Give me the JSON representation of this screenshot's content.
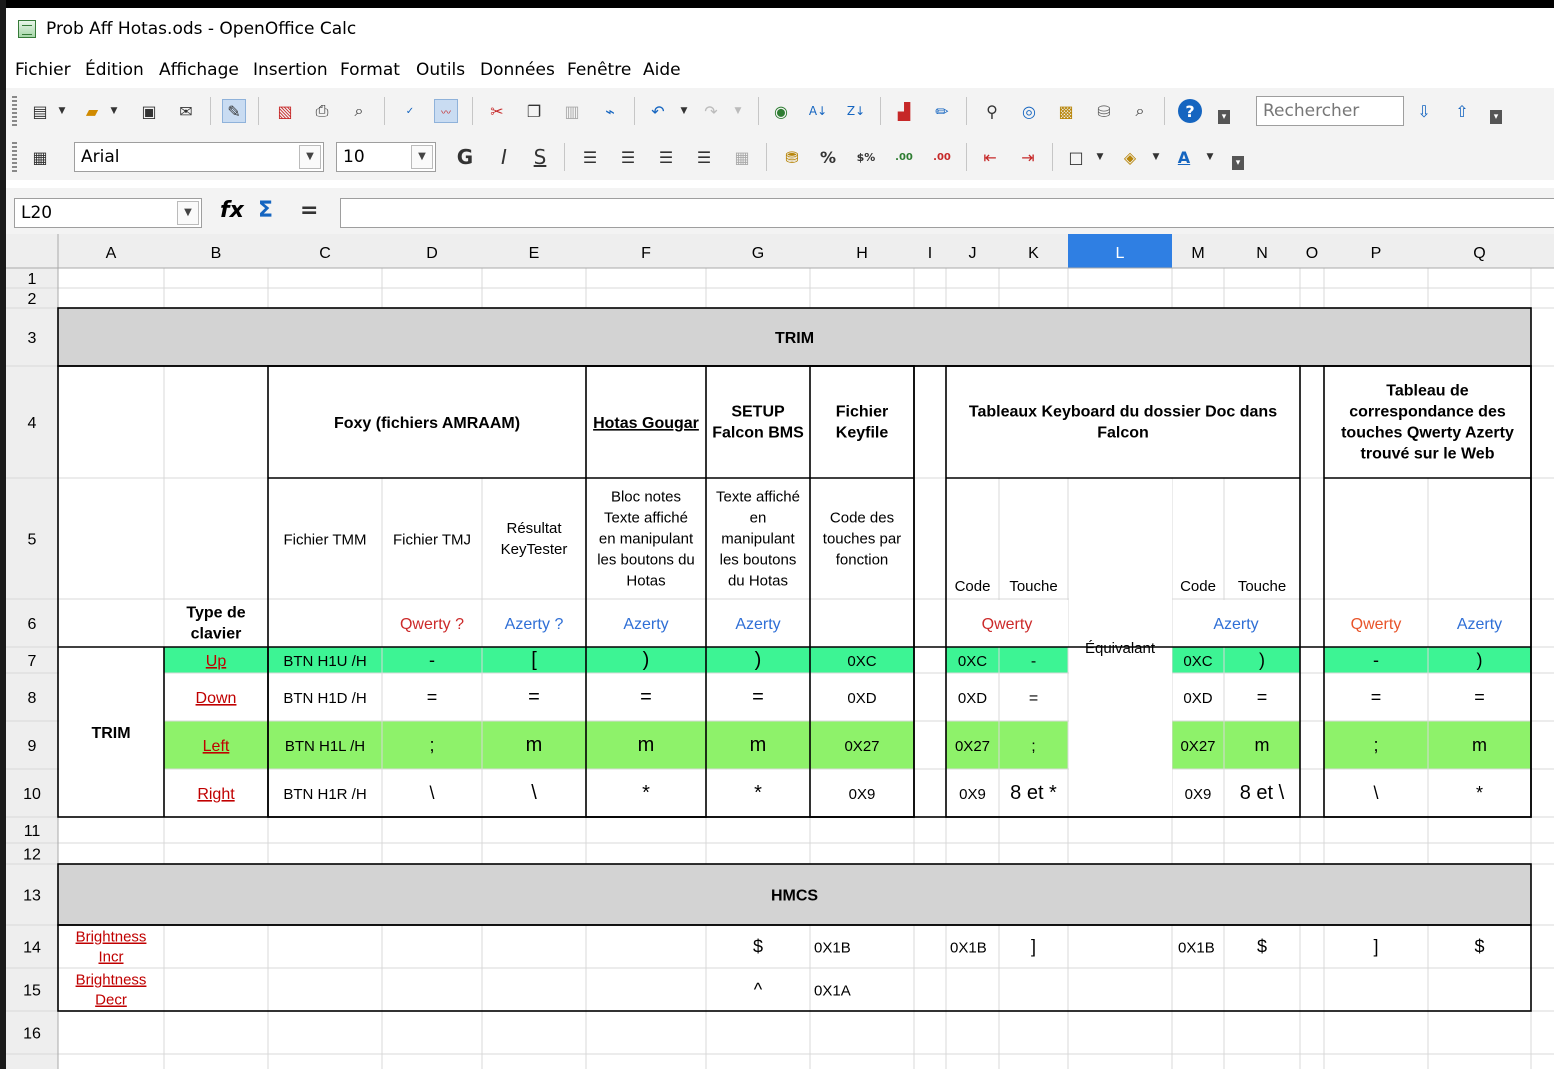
{
  "window": {
    "title": "Prob Aff Hotas.ods - OpenOffice Calc"
  },
  "menu": [
    "Fichier",
    "Édition",
    "Affichage",
    "Insertion",
    "Format",
    "Outils",
    "Données",
    "Fenêtre",
    "Aide"
  ],
  "toolbar": {
    "search_placeholder": "Rechercher",
    "font_name": "Arial",
    "font_size": "10"
  },
  "formula_bar": {
    "cell_ref": "L20",
    "content": ""
  },
  "columns": [
    "A",
    "B",
    "C",
    "D",
    "E",
    "F",
    "G",
    "H",
    "I",
    "J",
    "K",
    "L",
    "M",
    "N",
    "O",
    "P",
    "Q"
  ],
  "rows": [
    "1",
    "2",
    "3",
    "4",
    "5",
    "6",
    "7",
    "8",
    "9",
    "10",
    "11",
    "12",
    "13",
    "14",
    "15",
    "16"
  ],
  "sheet": {
    "trim_header": "TRIM",
    "hmcs_header": "HMCS",
    "r4": {
      "foxy": "Foxy (fichiers AMRAAM)",
      "hotas": "Hotas Gougar",
      "setup": [
        "SETUP",
        "Falcon BMS"
      ],
      "fichier": [
        "Fichier",
        "Keyfile"
      ],
      "tableaux": [
        "Tableaux Keyboard du dossier Doc dans",
        "Falcon"
      ],
      "correspondance": [
        "Tableau de",
        "correspondance des",
        "touches Qwerty Azerty",
        "trouvé sur le Web"
      ]
    },
    "r5": {
      "tmm": "Fichier TMM",
      "tmj": "Fichier TMJ",
      "resultat": [
        "Résultat",
        "KeyTester"
      ],
      "bloc": [
        "Bloc notes",
        "Texte affiché",
        "en manipulant",
        "les boutons du",
        "Hotas"
      ],
      "texte": [
        "Texte affiché",
        "en",
        "manipulant",
        "les boutons",
        "du Hotas"
      ],
      "code_fn": [
        "Code des",
        "touches par",
        "fonction"
      ],
      "code": "Code",
      "touche": "Touche"
    },
    "r6": {
      "type": [
        "Type de",
        "clavier"
      ],
      "qwerty_q": "Qwerty ?",
      "azerty_q": "Azerty ?",
      "azerty": "Azerty",
      "qwerty": "Qwerty",
      "equivalent": "Équivalant"
    },
    "trim_label": "TRIM",
    "trim_rows": [
      {
        "key": "Up",
        "btn": "BTN H1U /H",
        "d": "-",
        "e": "[",
        "f": ")",
        "g": ")",
        "h": "0XC",
        "j": "0XC",
        "k": "-",
        "m": "0XC",
        "n": ")",
        "p": "-",
        "q": ")"
      },
      {
        "key": "Down",
        "btn": "BTN H1D /H",
        "d": "=",
        "e": "=",
        "f": "=",
        "g": "=",
        "h": "0XD",
        "j": "0XD",
        "k": "=",
        "m": "0XD",
        "n": "=",
        "p": "=",
        "q": "="
      },
      {
        "key": "Left",
        "btn": "BTN H1L /H",
        "d": ";",
        "e": "m",
        "f": "m",
        "g": "m",
        "h": "0X27",
        "j": "0X27",
        "k": ";",
        "m": "0X27",
        "n": "m",
        "p": ";",
        "q": "m"
      },
      {
        "key": "Right",
        "btn": "BTN H1R /H",
        "d": "\\",
        "e": "\\",
        "f": "*",
        "g": "*",
        "h": "0X9",
        "j": "0X9",
        "k": "8 et *",
        "m": "0X9",
        "n": "8 et \\",
        "p": "\\",
        "q": "*"
      }
    ],
    "hmcs_rows": [
      {
        "label": [
          "Brightness",
          "Incr"
        ],
        "g": "$",
        "h": "0X1B",
        "j": "0X1B",
        "k": "]",
        "m": "0X1B",
        "n": "$",
        "p": "]",
        "q": "$"
      },
      {
        "label": [
          "Brightness",
          "Decr"
        ],
        "g": "^",
        "h": "0X1A",
        "j": "",
        "k": "",
        "m": "",
        "n": "",
        "p": "",
        "q": ""
      }
    ]
  },
  "colors": {
    "header_gray": "#d3d3d3",
    "row_green": "#3df494",
    "row_lightgreen": "#8ef26a",
    "red": "#cc2a2a",
    "blue": "#2f6fd6",
    "orange": "#e8542a"
  }
}
